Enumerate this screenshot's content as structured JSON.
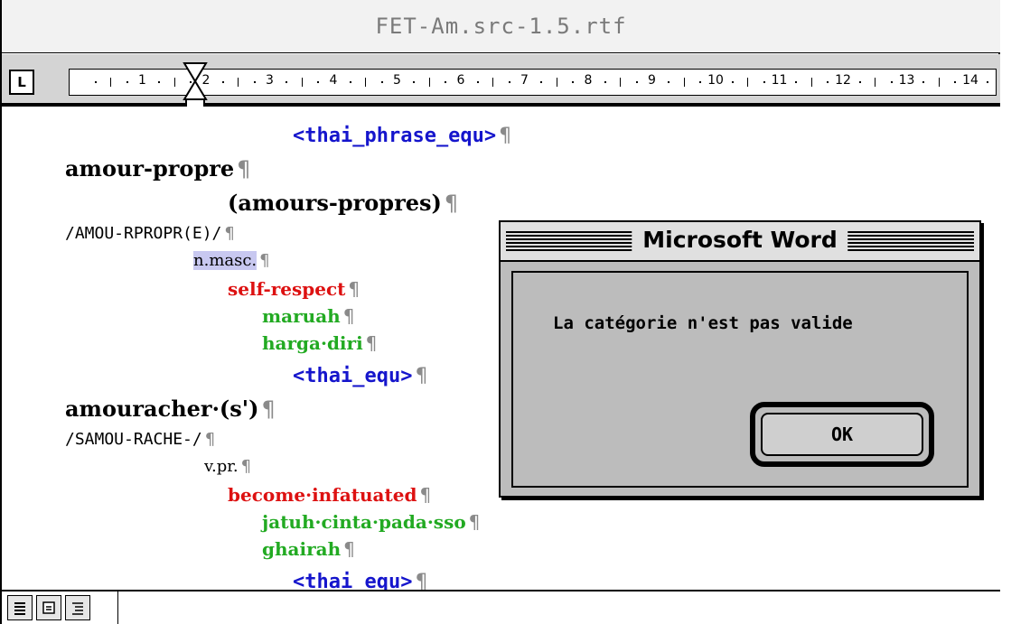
{
  "window": {
    "title": "FET-Am.src-1.5.rtf"
  },
  "ruler": {
    "tab_selector": "L",
    "numbers": [
      "1",
      "2",
      "3",
      "4",
      "5",
      "6",
      "7",
      "8",
      "9",
      "10",
      "11",
      "12",
      "13",
      "14"
    ]
  },
  "document": {
    "lines": [
      {
        "text": "<thai_phrase_equ>",
        "style": "blue"
      },
      {
        "text": "amour-propre",
        "style": "head"
      },
      {
        "text": "(amours-propres)",
        "style": "head"
      },
      {
        "text": "/AMOU-RPROPR(E)/",
        "style": "phon"
      },
      {
        "text": "n.masc.",
        "style": "pos-highlight"
      },
      {
        "text": "self-respect",
        "style": "red"
      },
      {
        "text": "maruah",
        "style": "green"
      },
      {
        "text": "harga·diri",
        "style": "green"
      },
      {
        "text": "<thai_equ>",
        "style": "blue"
      },
      {
        "text": "amouracher·(s')",
        "style": "head"
      },
      {
        "text": "/SAMOU-RACHE-/",
        "style": "phon"
      },
      {
        "text": "v.pr.",
        "style": "pos"
      },
      {
        "text": "become·infatuated",
        "style": "red"
      },
      {
        "text": "jatuh·cinta·pada·sso",
        "style": "green"
      },
      {
        "text": "ghairah",
        "style": "green"
      },
      {
        "text": "<thai_equ>",
        "style": "blue"
      }
    ],
    "pilcrow": "¶"
  },
  "dialog": {
    "title": "Microsoft Word",
    "message": "La catégorie n'est pas valide",
    "ok_label": "OK"
  },
  "statusbar": {
    "view_icons": [
      "normal-view-icon",
      "page-layout-view-icon",
      "outline-view-icon"
    ]
  },
  "colors": {
    "tag_blue": "#1515cc",
    "sense_red": "#dd1111",
    "translation_green": "#22aa22",
    "selection": "#c8c8f0"
  }
}
